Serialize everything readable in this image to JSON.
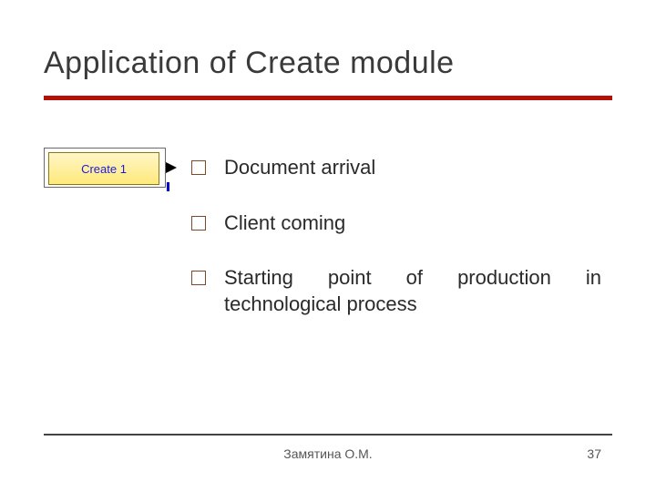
{
  "slide": {
    "title": "Application of Create module",
    "module_label": "Create 1",
    "bullets": [
      "Document arrival",
      "Client coming",
      "Starting point of production in technological process"
    ],
    "footer_author": "Замятина О.М.",
    "page_number": "37"
  }
}
